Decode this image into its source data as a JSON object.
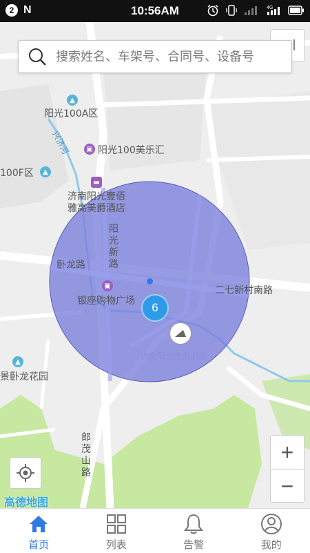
{
  "status_bar": {
    "notification_count": "2",
    "app_letter": "N",
    "time": "10:56AM",
    "network": "4G"
  },
  "search": {
    "placeholder": "搜索姓名、车架号、合同号、设备号"
  },
  "map": {
    "labels": {
      "yangguang_100a": "阳光100A区",
      "xingji_he": "兴济河",
      "yangguang_meile": "阳光100美乐汇",
      "area_100f": "100F区",
      "hotel_line1": "济南阳光壹佰",
      "hotel_line2": "雅高美爵酒店",
      "yangguang_road": "阳光新路",
      "wolong_road": "卧龙路",
      "erqi_road": "二七新村南路",
      "yinzuo_mall": "银座购物广场",
      "faded_label": "济南阳光壹佰酒店",
      "wolong_garden": "景卧龙花园",
      "langmao_road": "郎茂山路"
    },
    "cluster_count": "6",
    "provider_logo": "高德地图",
    "colors": {
      "geofence_fill": "#7a7fdc",
      "cluster": "#2f9be6",
      "accent": "#2f7be6",
      "green_area": "#c6e8a0"
    }
  },
  "controls": {
    "zoom_in": "+",
    "zoom_out": "−"
  },
  "tabs": [
    {
      "label": "首页",
      "icon": "home-icon",
      "active": true
    },
    {
      "label": "列表",
      "icon": "grid-icon",
      "active": false
    },
    {
      "label": "告警",
      "icon": "bell-icon",
      "active": false
    },
    {
      "label": "我的",
      "icon": "user-icon",
      "active": false
    }
  ]
}
